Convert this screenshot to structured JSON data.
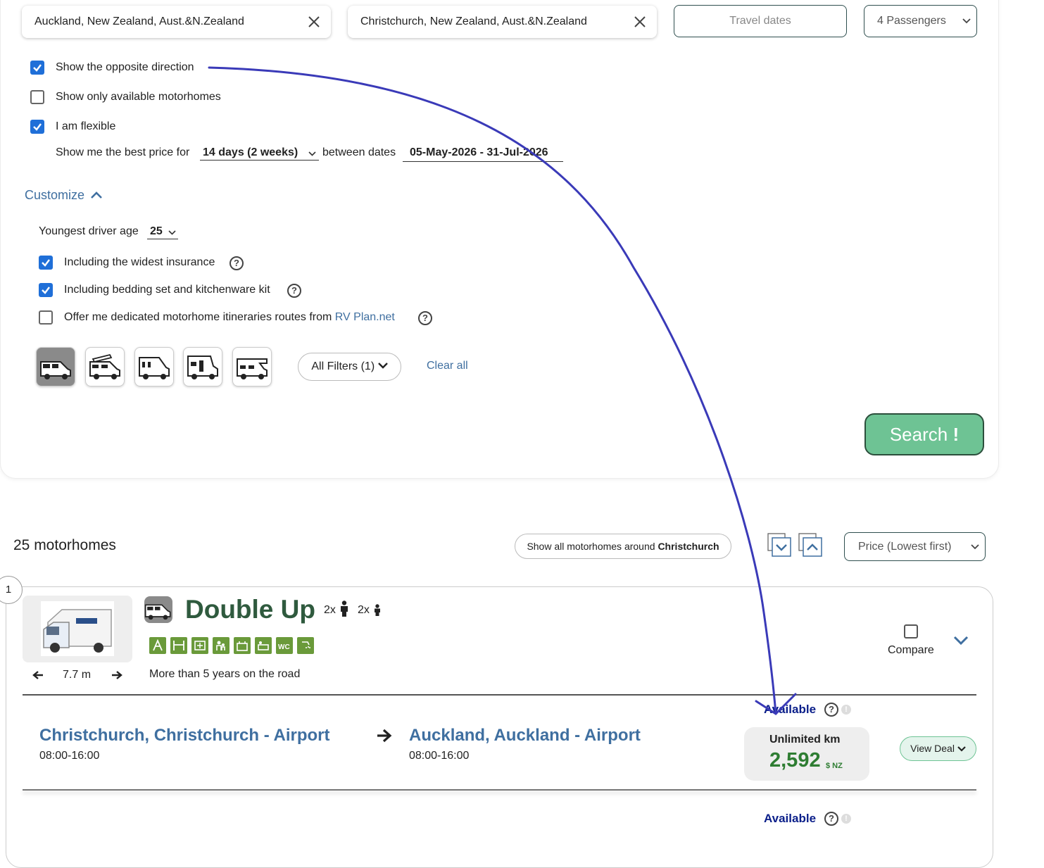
{
  "search": {
    "pickup": "Auckland, New Zealand, Aust.&N.Zealand",
    "dropoff": "Christchurch, New Zealand, Aust.&N.Zealand",
    "dates_placeholder": "Travel dates",
    "passengers": "4 Passengers"
  },
  "options": {
    "opposite_direction": "Show the opposite direction",
    "only_available": "Show only available motorhomes",
    "flexible": "I am flexible",
    "best_price_prefix": "Show me the best price for",
    "duration": "14 days (2 weeks)",
    "between_dates": "between dates",
    "date_range": "05-May-2026 - 31-Jul-2026"
  },
  "customize": {
    "label": "Customize",
    "driver_age_label": "Youngest driver age",
    "driver_age": "25",
    "widest_insurance": "Including the widest insurance",
    "bedding_kit": "Including bedding set and kitchenware kit",
    "itineraries_prefix": "Offer me dedicated motorhome itineraries routes from",
    "itineraries_link": "RV Plan.net",
    "all_filters": "All Filters (1)",
    "clear_all": "Clear all",
    "search_button": "Search",
    "search_button_mark": "!"
  },
  "results": {
    "count_text": "25 motorhomes",
    "around_prefix": "Show all motorhomes around",
    "around_city": "Christchurch",
    "sort": "Price (Lowest first)"
  },
  "listing": {
    "rank": "1",
    "name": "Double Up",
    "adults": "2x",
    "children": "2x",
    "length": "7.7 m",
    "age_note": "More than 5 years on the road",
    "compare": "Compare",
    "from_place": "Christchurch, Christchurch - Airport",
    "from_time": "08:00-16:00",
    "to_place": "Auckland, Auckland - Airport",
    "to_time": "08:00-16:00",
    "availability": "Available",
    "km": "Unlimited km",
    "price": "2,592",
    "currency": "$ NZ",
    "view_deal": "View Deal",
    "availability_2": "Available"
  },
  "colors": {
    "accent_blue": "#3f6fa0",
    "checkbox_blue": "#1f6fd8",
    "price_green": "#2e7d32",
    "search_green": "#6ec394",
    "amenity_green": "#6a9a3a",
    "annotation_stroke": "#3a3ab8"
  }
}
